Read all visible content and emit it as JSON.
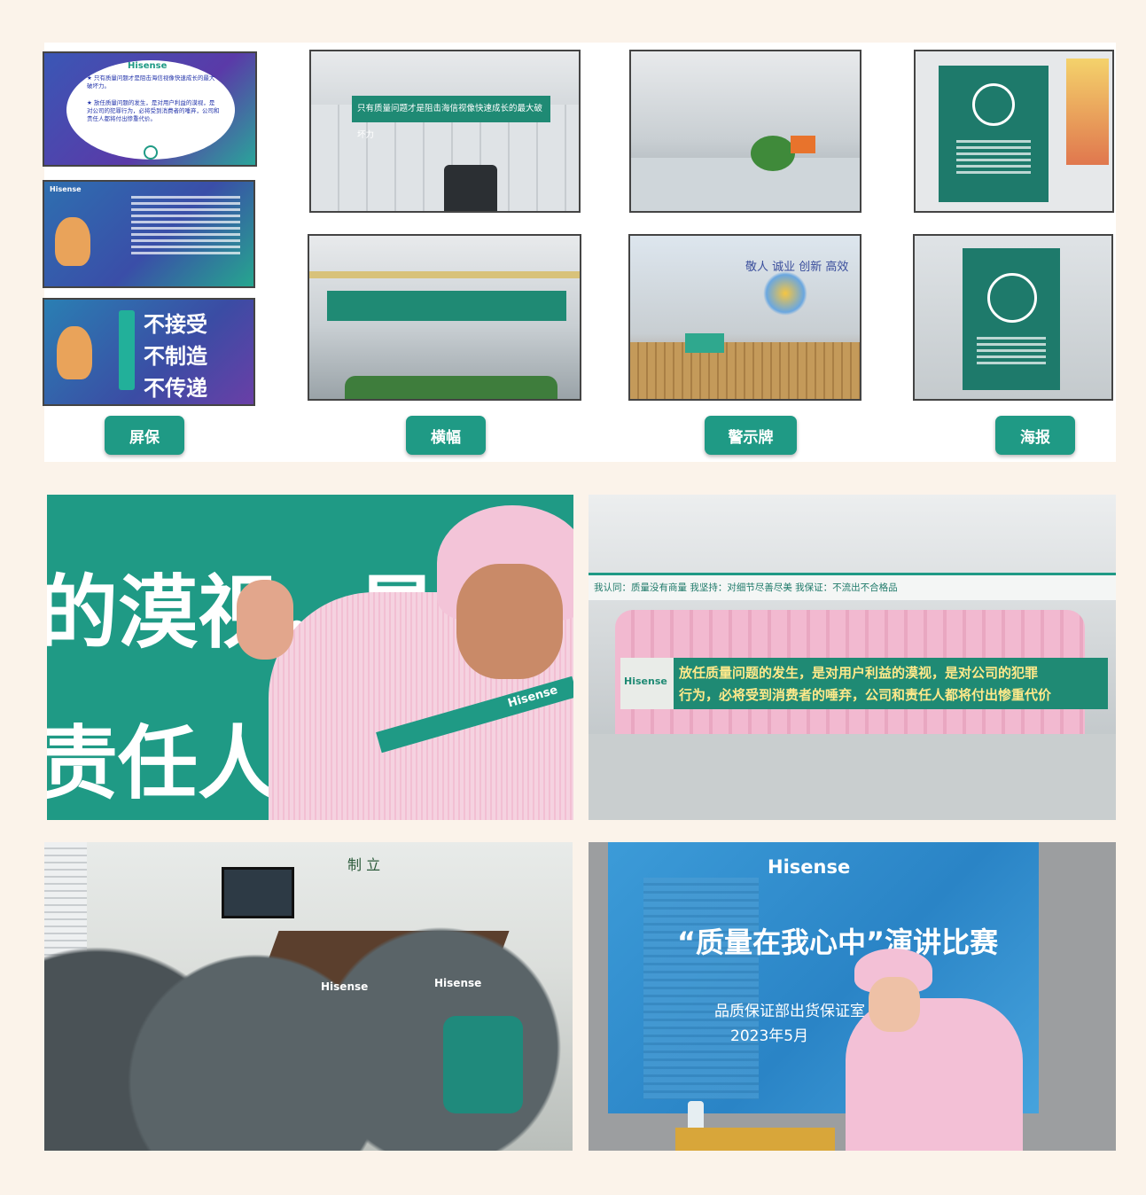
{
  "top_panel": {
    "screensaver": {
      "logo": "Hisense",
      "bullet1": "★ 只有质量问题才是阻击海信视像快速成长的最大破坏力。",
      "bullet2": "★ 放任质量问题的发生，是对用户利益的漠视，是对公司的犯罪行为，必将受到消费者的唾弃，公司和责任人都将付出惨重代价。",
      "slogan_1": "不接受",
      "slogan_2": "不制造",
      "slogan_3": "不传递"
    },
    "banner_text": "只有质量问题才是阻击海信视像快速成长的最大破坏力",
    "wall_text": "敬人 诚业 创新 高效",
    "labels": [
      "屏保",
      "横幅",
      "警示牌",
      "海报"
    ]
  },
  "signing_photo": {
    "banner_line1": "的漠视，是对公司",
    "banner_line2": "责任人都将付",
    "lanyard": "Hisense"
  },
  "group_photo": {
    "wall_slogan": "我认同：质量没有商量    我坚持：对细节尽善尽美    我保证：不流出不合格品",
    "banner_brand": "Hisense",
    "banner_line1": "放任质量问题的发生，是对用户利益的漠视，是对公司的犯罪",
    "banner_line2": "行为，必将受到消费者的唾弃，公司和责任人都将付出惨重代价"
  },
  "meeting_photo": {
    "shirt_logo": "Hisense",
    "wall_chars": "制  立"
  },
  "speech_photo": {
    "logo": "Hisense",
    "title": "“质量在我心中”演讲比赛",
    "department": "品质保证部出货保证室",
    "date": "2023年5月"
  },
  "colors": {
    "accent": "#1f9a85",
    "background": "#fbf3ea",
    "pink": "#f2b9d0"
  }
}
